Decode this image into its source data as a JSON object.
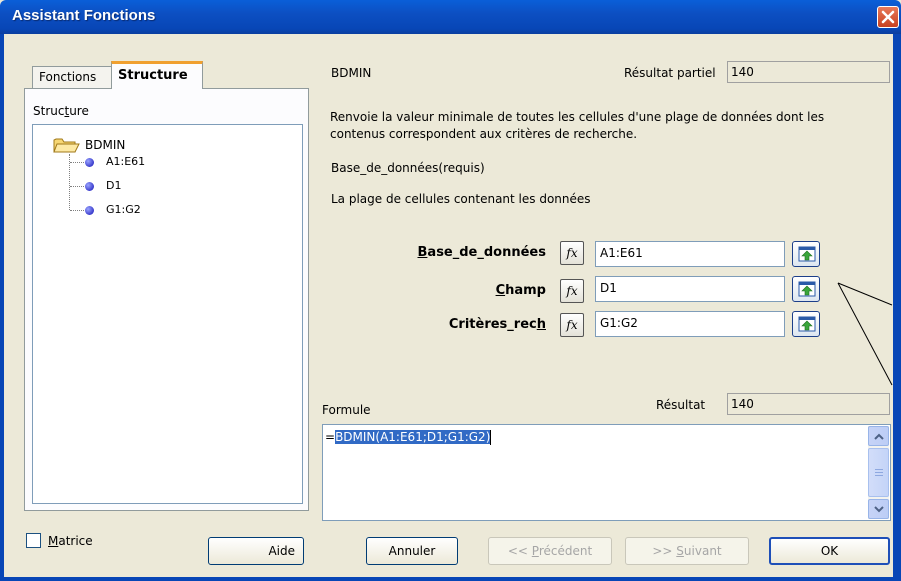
{
  "window": {
    "title": "Assistant Fonctions"
  },
  "tabs": {
    "fonctions": "Fonctions",
    "structure": "Structure"
  },
  "structure_panel": {
    "label": "Structure",
    "root": "BDMIN",
    "items": [
      "A1:E61",
      "D1",
      "G1:G2"
    ]
  },
  "function": {
    "name": "BDMIN",
    "partial_result_label": "Résultat partiel",
    "partial_result": "140",
    "description": "Renvoie la valeur minimale de toutes les cellules d'une plage de données dont les contenus correspondent aux critères de recherche.",
    "current_arg": "Base_de_données(requis)",
    "current_arg_desc": "La plage de cellules contenant les données"
  },
  "args": [
    {
      "label_before": "",
      "label_underline": "B",
      "label_after": "ase_de_données",
      "value": "A1:E61"
    },
    {
      "label_before": "",
      "label_underline": "C",
      "label_after": "hamp",
      "value": "D1"
    },
    {
      "label_before": "Critères_rec",
      "label_underline": "h",
      "label_after": "",
      "value": "G1:G2"
    }
  ],
  "fx_label": "fx",
  "formula": {
    "label": "Formule",
    "result_label": "Résultat",
    "result": "140",
    "eq": "=",
    "text": "BDMIN(A1:E61;D1;G1:G2)"
  },
  "matrix": {
    "label_underline": "M",
    "label_rest": "atrice",
    "checked": false
  },
  "buttons": {
    "aide": "Aide",
    "annuler": "Annuler",
    "prev_prefix": "<< ",
    "prev_underline": "P",
    "prev_rest": "récédent",
    "next_prefix": ">> ",
    "next_underline": "S",
    "next_rest": "uivant",
    "ok": "OK"
  },
  "colors": {
    "title_bar": "#0a5fd8",
    "selection": "#316ac5",
    "tab_highlight": "#f0a030"
  }
}
